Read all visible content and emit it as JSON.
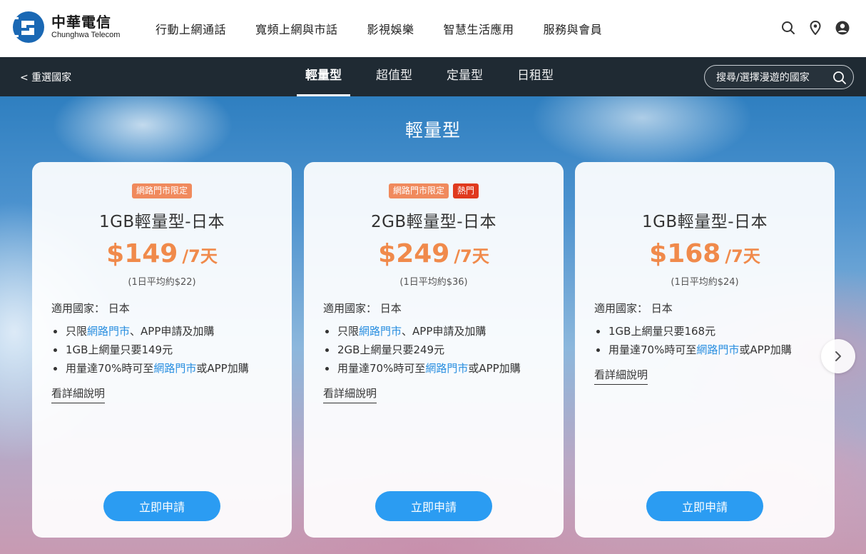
{
  "brand": {
    "name_cn": "中華電信",
    "name_en": "Chunghwa Telecom",
    "color": "#1a68b4"
  },
  "main_nav": [
    {
      "label": "行動上網通話"
    },
    {
      "label": "寬頻上網與市話"
    },
    {
      "label": "影視娛樂"
    },
    {
      "label": "智慧生活應用"
    },
    {
      "label": "服務與會員"
    }
  ],
  "header_icons": [
    "search-icon",
    "location-pin-icon",
    "user-account-icon"
  ],
  "subnav": {
    "back_label": "< 重選國家",
    "tabs": [
      {
        "label": "輕量型",
        "active": true
      },
      {
        "label": "超值型",
        "active": false
      },
      {
        "label": "定量型",
        "active": false
      },
      {
        "label": "日租型",
        "active": false
      }
    ],
    "search_placeholder": "搜尋/選擇漫遊的國家"
  },
  "section_title": "輕量型",
  "cards": [
    {
      "badges": [
        "網路門市限定"
      ],
      "name": "1GB輕量型-日本",
      "price": "$149",
      "period": "/7天",
      "avg": "(1日平均約$22)",
      "country": "適用國家： 日本",
      "features": [
        {
          "pre": "只限",
          "link": "網路門市",
          "post": "、APP申請及加購"
        },
        {
          "pre": "1GB上網量只要149元",
          "link": "",
          "post": ""
        },
        {
          "pre": "用量達70%時可至",
          "link": "網路門市",
          "post": "或APP加購"
        }
      ],
      "detail_label": "看詳細說明",
      "apply_label": "立即申請"
    },
    {
      "badges": [
        "網路門市限定",
        "熱門"
      ],
      "name": "2GB輕量型-日本",
      "price": "$249",
      "period": "/7天",
      "avg": "(1日平均約$36)",
      "country": "適用國家： 日本",
      "features": [
        {
          "pre": "只限",
          "link": "網路門市",
          "post": "、APP申請及加購"
        },
        {
          "pre": "2GB上網量只要249元",
          "link": "",
          "post": ""
        },
        {
          "pre": "用量達70%時可至",
          "link": "網路門市",
          "post": "或APP加購"
        }
      ],
      "detail_label": "看詳細說明",
      "apply_label": "立即申請"
    },
    {
      "badges": [],
      "name": "1GB輕量型-日本",
      "price": "$168",
      "period": "/7天",
      "avg": "(1日平均約$24)",
      "country": "適用國家： 日本",
      "features": [
        {
          "pre": "1GB上網量只要168元",
          "link": "",
          "post": ""
        },
        {
          "pre": "用量達70%時可至",
          "link": "網路門市",
          "post": "或APP加購"
        }
      ],
      "detail_label": "看詳細說明",
      "apply_label": "立即申請"
    }
  ],
  "colors": {
    "accent_price": "#f08a4b",
    "button": "#2b9cf2",
    "link": "#2a8fe0",
    "subnav_bg": "#1f2a33",
    "badge_limited": "#f08a5d",
    "badge_hot": "#e03a1e"
  }
}
